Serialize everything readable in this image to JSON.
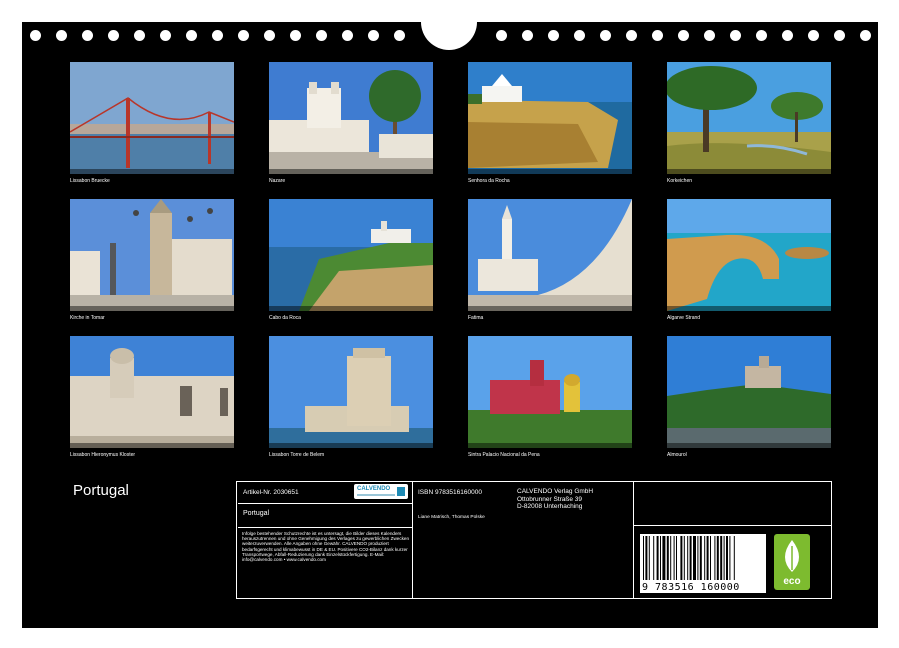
{
  "photos": [
    {
      "caption": "Lissabon Bruecke"
    },
    {
      "caption": "Nazare"
    },
    {
      "caption": "Senhora da Rocha"
    },
    {
      "caption": "Korkeichen"
    },
    {
      "caption": "Kirche in Tomar"
    },
    {
      "caption": "Cabo da Roca"
    },
    {
      "caption": "Fatima"
    },
    {
      "caption": "Algarve Strand"
    },
    {
      "caption": "Lissabon Hieronymus Kloster"
    },
    {
      "caption": "Lissabon Torre de Belem"
    },
    {
      "caption": "Sintra Palacio Nacional da Pena"
    },
    {
      "caption": "Almourol"
    }
  ],
  "calendar": {
    "title": "Portugal"
  },
  "product": {
    "article_no": "Artikel-Nr. 2030651",
    "name": "Portugal",
    "brand": "CALVENDO",
    "legal_text": "Infolge bestehender Schutzrechte ist es untersagt, die Bilder dieses Kalenders herauszutrennen und ohne Genehmigung des Verlages zu gewerblichen Zwecken weiterzuverwenden. Alle Angaben ohne Gewähr. CALVENDO produziert bedarfsgerecht und klimabewusst in DE & EU. Positivere CO2-Bilanz dank kurzer Transportwege, Abfall-Reduzierung dank Einzelstückfertigung. E-Mail: info@calvendo.com • www.calvendo.com",
    "isbn": "ISBN 9783516160000",
    "authors": "Liane Matrisch, Thomas Polske",
    "publisher_lines": [
      "CALVENDO Verlag GmbH",
      "Ottobrunner Straße 39",
      "D-82008 Unterhaching"
    ],
    "barcode_digits": "9 783516 160000",
    "eco_label": "eco"
  }
}
